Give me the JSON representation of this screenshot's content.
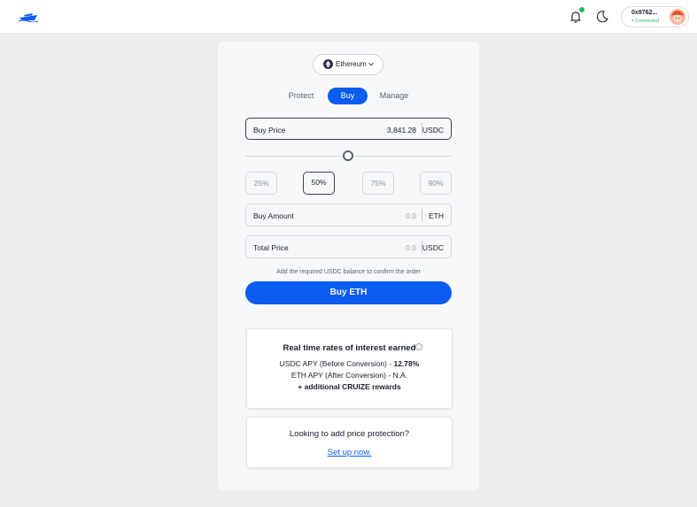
{
  "header": {
    "wallet_address": "0x9762...",
    "wallet_status": "Connected"
  },
  "network": {
    "selected": "Ethereum"
  },
  "tabs": [
    {
      "label": "Protect"
    },
    {
      "label": "Buy"
    },
    {
      "label": "Manage"
    }
  ],
  "buy_price": {
    "label": "Buy Price",
    "value": "3,841.28",
    "unit": "USDC"
  },
  "slider": {
    "position_fraction": 0.5
  },
  "percent_options": [
    "25%",
    "50%",
    "75%",
    "90%"
  ],
  "buy_amount": {
    "label": "Buy Amount",
    "value": "0.0",
    "unit": "ETH"
  },
  "total_price": {
    "label": "Total Price",
    "value": "0.0",
    "unit": "USDC"
  },
  "hint": "Add the required USDC balance to confirm the order",
  "buy_button": "Buy ETH",
  "rates": {
    "title": "Real time rates of interest earned",
    "usdc_label": "USDC APY",
    "usdc_note": " (Before Conversion) - ",
    "usdc_value": "12.78%",
    "eth_label": "ETH APY",
    "eth_note": " (After Conversion) - ",
    "eth_value": "N.A.",
    "rewards": "+ additional CRUIZE rewards"
  },
  "protection": {
    "question": "Looking to add price protection?",
    "link": "Set up now."
  },
  "colors": {
    "accent": "#0b5cf0",
    "connected": "#28b463"
  }
}
